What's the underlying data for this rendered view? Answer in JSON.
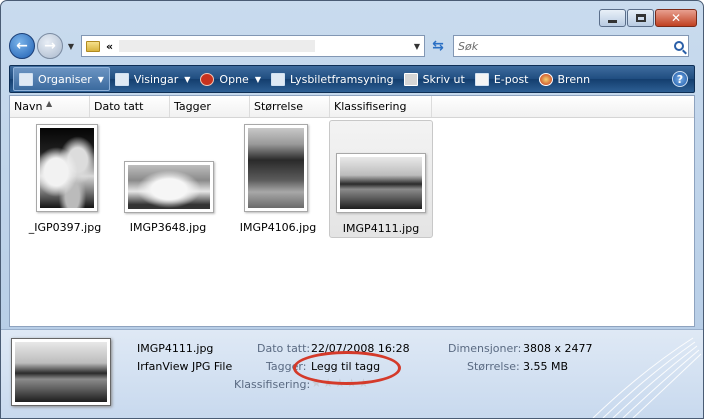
{
  "window": {
    "caption": {
      "minimize_icon": "minimize-icon",
      "maximize_icon": "maximize-icon",
      "close_icon": "close-icon"
    }
  },
  "nav": {
    "address_separator": "«",
    "search_placeholder": "Søk"
  },
  "toolbar": {
    "organise": "Organiser",
    "views": "Visingar",
    "open": "Opne",
    "slideshow": "Lysbiletframsyning",
    "print": "Skriv ut",
    "email": "E-post",
    "burn": "Brenn",
    "help": "?"
  },
  "columns": [
    "Navn",
    "Dato tatt",
    "Tagger",
    "Størrelse",
    "Klassifisering"
  ],
  "files": [
    {
      "name": "_IGP0397.jpg"
    },
    {
      "name": "IMGP3648.jpg"
    },
    {
      "name": "IMGP4106.jpg"
    },
    {
      "name": "IMGP4111.jpg",
      "selected": true
    }
  ],
  "details": {
    "file_name": "IMGP4111.jpg",
    "file_type": "IrfanView JPG File",
    "date_label": "Dato tatt:",
    "date_value": "22/07/2008 16:28",
    "tags_label": "Tagger:",
    "tags_value": "Legg til tagg",
    "rating_label": "Klassifisering:",
    "rating_value": 0,
    "dimensions_label": "Dimensjoner:",
    "dimensions_value": "3808 x 2477",
    "size_label": "Størrelse:",
    "size_value": "3.55 MB"
  },
  "colors": {
    "highlight_ring": "#d43a2a",
    "command_bar": "#1f4d80"
  }
}
